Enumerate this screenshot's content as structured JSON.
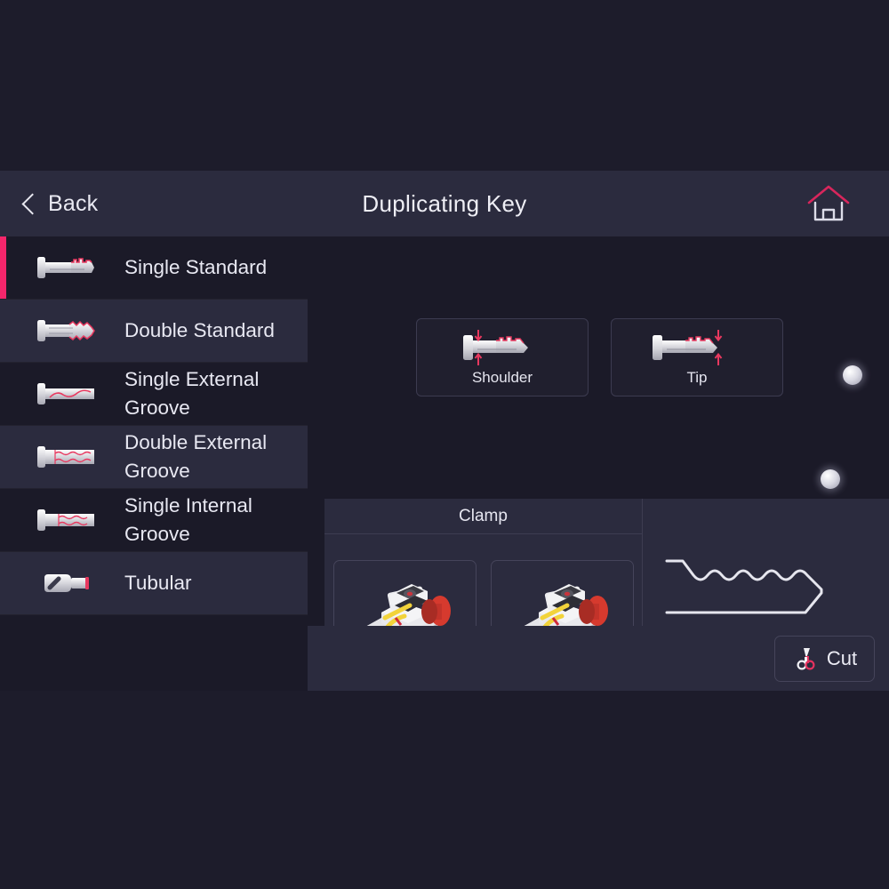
{
  "header": {
    "back_label": "Back",
    "title": "Duplicating Key",
    "back_icon": "chevron-left-icon",
    "home_icon": "home-icon"
  },
  "sidebar": {
    "items": [
      {
        "label": "Single Standard",
        "icon": "key-single-standard-icon",
        "selected": true,
        "tint": false
      },
      {
        "label": "Double Standard",
        "icon": "key-double-standard-icon",
        "selected": false,
        "tint": true
      },
      {
        "label": "Single External Groove",
        "icon": "key-single-external-groove-icon",
        "selected": false,
        "tint": false
      },
      {
        "label": "Double External Groove",
        "icon": "key-double-external-groove-icon",
        "selected": false,
        "tint": true
      },
      {
        "label": "Single Internal Groove",
        "icon": "key-single-internal-groove-icon",
        "selected": false,
        "tint": false
      },
      {
        "label": "Tubular",
        "icon": "key-tubular-icon",
        "selected": false,
        "tint": true
      }
    ]
  },
  "main": {
    "reference_modes": [
      {
        "label": "Shoulder",
        "icon": "key-shoulder-reference-icon"
      },
      {
        "label": "Tip",
        "icon": "key-tip-reference-icon"
      }
    ],
    "indicators": [
      {
        "name": "status-dot-upper"
      },
      {
        "name": "status-dot-lower"
      }
    ],
    "clamp": {
      "title": "Clamp",
      "options": [
        {
          "icon": "clamp-jaw-icon"
        },
        {
          "icon": "clamp-jaw-icon"
        }
      ]
    },
    "profile": {
      "icon": "key-cut-profile-icon"
    },
    "cut": {
      "label": "Cut",
      "icon": "cutter-icon"
    }
  },
  "colors": {
    "page_background": "#1d1c2b",
    "panel": "#2b2b3e",
    "app_background": "#1b1a28",
    "accent": "#f4266b",
    "text": "#e8e8f2",
    "border": "#45445a"
  }
}
